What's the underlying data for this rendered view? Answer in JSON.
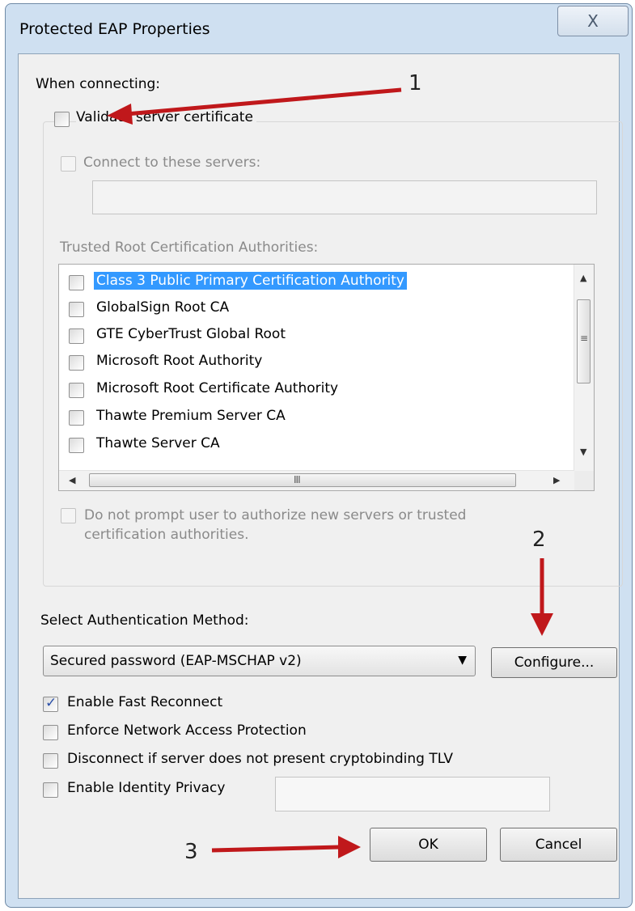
{
  "window": {
    "title": "Protected EAP Properties",
    "close_glyph": "X"
  },
  "when_connecting": {
    "label": "When connecting:",
    "validate_cert": {
      "label": "Validate server certificate",
      "checked": false
    },
    "connect_servers": {
      "label": "Connect to these servers:",
      "checked": false,
      "value": ""
    },
    "trusted_root_label": "Trusted Root Certification Authorities:",
    "ca_list": [
      {
        "label": "Class 3 Public Primary Certification Authority",
        "checked": false,
        "selected": true
      },
      {
        "label": "GlobalSign Root CA",
        "checked": false,
        "selected": false
      },
      {
        "label": "GTE CyberTrust Global Root",
        "checked": false,
        "selected": false
      },
      {
        "label": "Microsoft Root Authority",
        "checked": false,
        "selected": false
      },
      {
        "label": "Microsoft Root Certificate Authority",
        "checked": false,
        "selected": false
      },
      {
        "label": "Thawte Premium Server CA",
        "checked": false,
        "selected": false
      },
      {
        "label": "Thawte Server CA",
        "checked": false,
        "selected": false
      }
    ],
    "no_prompt": {
      "line1": "Do not prompt user to authorize new servers or trusted",
      "line2": "certification authorities.",
      "checked": false
    }
  },
  "auth": {
    "label": "Select Authentication Method:",
    "method": "Secured password (EAP-MSCHAP v2)",
    "configure_label": "Configure..."
  },
  "options": [
    {
      "label": "Enable Fast Reconnect",
      "checked": true
    },
    {
      "label": "Enforce Network Access Protection",
      "checked": false
    },
    {
      "label": "Disconnect if server does not present cryptobinding TLV",
      "checked": false
    },
    {
      "label": "Enable Identity Privacy",
      "checked": false
    }
  ],
  "identity_privacy_value": "",
  "buttons": {
    "ok": "OK",
    "cancel": "Cancel"
  },
  "annotations": {
    "one": "1",
    "two": "2",
    "three": "3",
    "color": "#c0181b"
  },
  "icons": {
    "check": "✓",
    "up": "▲",
    "down": "▼",
    "left": "◀",
    "right": "▶",
    "vgrip": "≡",
    "hgrip": "III",
    "dropdown": "▼"
  }
}
